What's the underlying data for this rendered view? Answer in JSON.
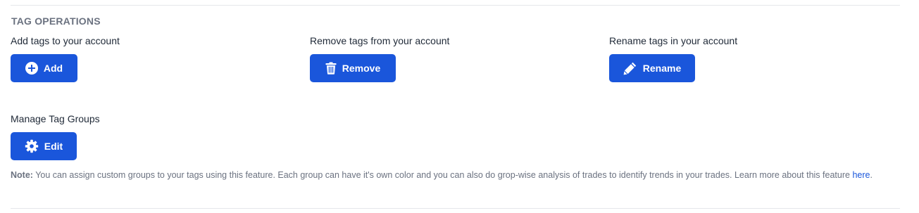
{
  "section": {
    "title": "TAG OPERATIONS"
  },
  "operations": {
    "add": {
      "label": "Add tags to your account",
      "button": "Add",
      "icon": "plus-circle-icon"
    },
    "remove": {
      "label": "Remove tags from your account",
      "button": "Remove",
      "icon": "trash-icon"
    },
    "rename": {
      "label": "Rename tags in your account",
      "button": "Rename",
      "icon": "pencil-icon"
    },
    "groups": {
      "label": "Manage Tag Groups",
      "button": "Edit",
      "icon": "gear-icon"
    }
  },
  "note": {
    "prefix": "Note:",
    "text": " You can assign custom groups to your tags using this feature. Each group can have it's own color and you can also do grop-wise analysis of trades to identify trends in your trades. Learn more about this feature ",
    "link": "here",
    "suffix": "."
  },
  "colors": {
    "button_bg": "#1a56db",
    "button_text": "#ffffff",
    "muted_text": "#6b7280",
    "link": "#1a56db"
  }
}
